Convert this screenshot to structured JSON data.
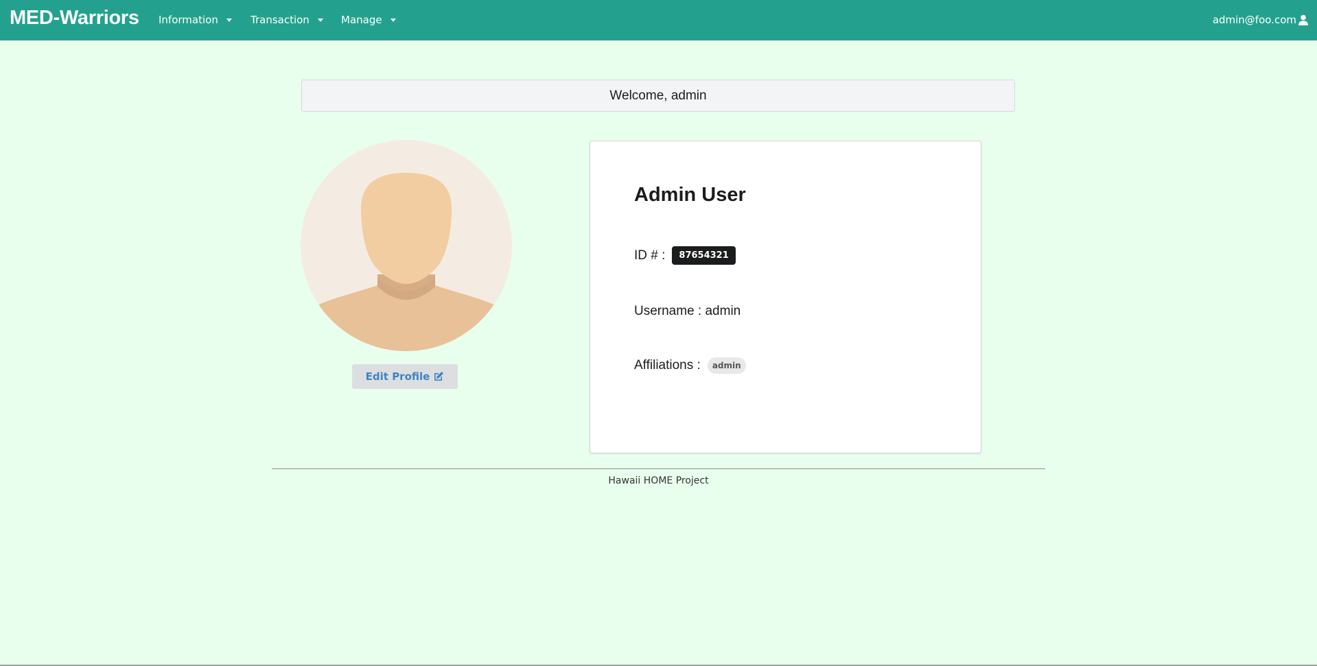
{
  "navbar": {
    "brand": "MED-Warriors",
    "menus": [
      {
        "label": "Information"
      },
      {
        "label": "Transaction"
      },
      {
        "label": "Manage"
      }
    ],
    "user_email": "admin@foo.com",
    "color": "#24a18e"
  },
  "welcome": {
    "text": "Welcome, admin"
  },
  "profile": {
    "avatar_icon": "user-silhouette",
    "edit_label": "Edit Profile",
    "edit_icon": "edit-icon",
    "name": "Admin User",
    "id_label": "ID # :",
    "id_value": "87654321",
    "username_label": "Username : admin",
    "affiliations_label": "Affiliations :",
    "affiliations": [
      "admin"
    ]
  },
  "footer": {
    "text": "Hawaii HOME Project"
  },
  "colors": {
    "background": "#e8ffee",
    "accent": "#24a18e",
    "link": "#4183c4"
  }
}
